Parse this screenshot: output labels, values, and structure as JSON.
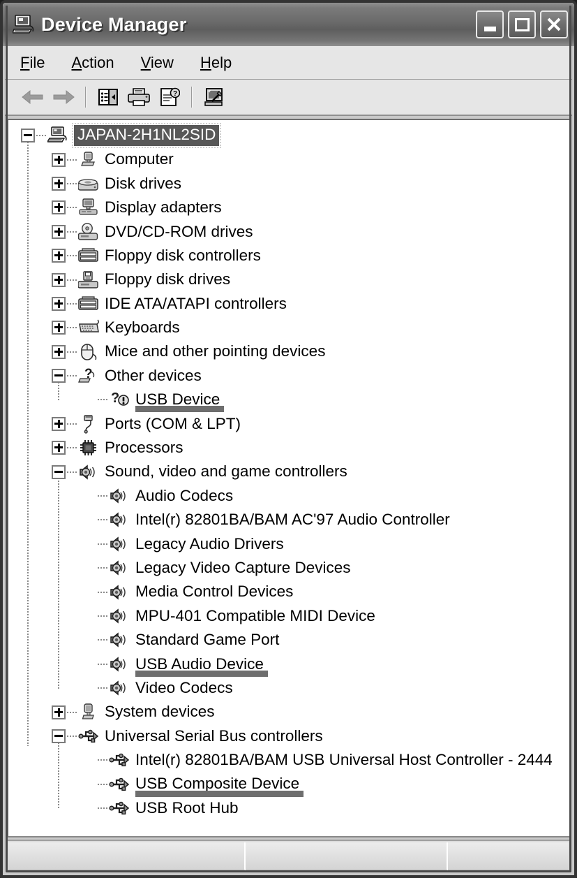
{
  "window": {
    "title": "Device Manager",
    "title_icon": "computer-icon",
    "caption_buttons": [
      {
        "name": "minimize",
        "label": "_"
      },
      {
        "name": "maximize",
        "label": "□"
      },
      {
        "name": "close",
        "label": "X"
      }
    ]
  },
  "menu": {
    "items": [
      {
        "label": "File",
        "accel": "F"
      },
      {
        "label": "Action",
        "accel": "A"
      },
      {
        "label": "View",
        "accel": "V"
      },
      {
        "label": "Help",
        "accel": "H"
      }
    ]
  },
  "toolbar": {
    "buttons": [
      {
        "name": "back-arrow-icon",
        "tip": "Back"
      },
      {
        "name": "forward-arrow-icon",
        "tip": "Forward"
      },
      {
        "name": "separator",
        "tip": ""
      },
      {
        "name": "show-console-tree-icon",
        "tip": "Show/Hide Console Tree"
      },
      {
        "name": "print-icon",
        "tip": "Print"
      },
      {
        "name": "properties-icon",
        "tip": "Properties"
      },
      {
        "name": "separator",
        "tip": ""
      },
      {
        "name": "scan-hardware-changes-icon",
        "tip": "Scan for hardware changes"
      }
    ]
  },
  "tree": {
    "rows": [
      {
        "id": "root",
        "depth": 0,
        "state": "expanded",
        "icon": "computer-icon",
        "label": "JAPAN-2H1NL2SID",
        "selected": true,
        "annotated": false
      },
      {
        "id": "computer",
        "depth": 1,
        "state": "collapsed",
        "icon": "computer-node-icon",
        "label": "Computer",
        "selected": false,
        "annotated": false
      },
      {
        "id": "disk",
        "depth": 1,
        "state": "collapsed",
        "icon": "disk-drive-icon",
        "label": "Disk drives",
        "selected": false,
        "annotated": false
      },
      {
        "id": "display",
        "depth": 1,
        "state": "collapsed",
        "icon": "display-adapter-icon",
        "label": "Display adapters",
        "selected": false,
        "annotated": false
      },
      {
        "id": "dvd",
        "depth": 1,
        "state": "collapsed",
        "icon": "dvd-drive-icon",
        "label": "DVD/CD-ROM drives",
        "selected": false,
        "annotated": false
      },
      {
        "id": "fdc",
        "depth": 1,
        "state": "collapsed",
        "icon": "controller-icon",
        "label": "Floppy disk controllers",
        "selected": false,
        "annotated": false
      },
      {
        "id": "fdd",
        "depth": 1,
        "state": "collapsed",
        "icon": "floppy-drive-icon",
        "label": "Floppy disk drives",
        "selected": false,
        "annotated": false
      },
      {
        "id": "ide",
        "depth": 1,
        "state": "collapsed",
        "icon": "controller-icon",
        "label": "IDE ATA/ATAPI controllers",
        "selected": false,
        "annotated": false
      },
      {
        "id": "keyboards",
        "depth": 1,
        "state": "collapsed",
        "icon": "keyboard-icon",
        "label": "Keyboards",
        "selected": false,
        "annotated": false
      },
      {
        "id": "mice",
        "depth": 1,
        "state": "collapsed",
        "icon": "mouse-icon",
        "label": "Mice and other pointing devices",
        "selected": false,
        "annotated": false
      },
      {
        "id": "other",
        "depth": 1,
        "state": "expanded",
        "icon": "unknown-device-icon",
        "label": "Other devices",
        "selected": false,
        "annotated": false
      },
      {
        "id": "usbdev",
        "depth": 2,
        "state": "leaf",
        "icon": "unknown-warning-icon",
        "label": "USB Device",
        "selected": false,
        "annotated": true
      },
      {
        "id": "ports",
        "depth": 1,
        "state": "collapsed",
        "icon": "port-icon",
        "label": "Ports (COM & LPT)",
        "selected": false,
        "annotated": false
      },
      {
        "id": "cpu",
        "depth": 1,
        "state": "collapsed",
        "icon": "processor-icon",
        "label": "Processors",
        "selected": false,
        "annotated": false
      },
      {
        "id": "sound",
        "depth": 1,
        "state": "expanded",
        "icon": "speaker-icon",
        "label": "Sound, video and game controllers",
        "selected": false,
        "annotated": false
      },
      {
        "id": "audcodec",
        "depth": 2,
        "state": "leaf",
        "icon": "speaker-icon",
        "label": "Audio Codecs",
        "selected": false,
        "annotated": false
      },
      {
        "id": "intelac97",
        "depth": 2,
        "state": "leaf",
        "icon": "speaker-icon",
        "label": "Intel(r) 82801BA/BAM AC'97 Audio Controller",
        "selected": false,
        "annotated": false
      },
      {
        "id": "legaudio",
        "depth": 2,
        "state": "leaf",
        "icon": "speaker-icon",
        "label": "Legacy Audio Drivers",
        "selected": false,
        "annotated": false
      },
      {
        "id": "legvideo",
        "depth": 2,
        "state": "leaf",
        "icon": "speaker-icon",
        "label": "Legacy Video Capture Devices",
        "selected": false,
        "annotated": false
      },
      {
        "id": "mediactl",
        "depth": 2,
        "state": "leaf",
        "icon": "speaker-icon",
        "label": "Media Control Devices",
        "selected": false,
        "annotated": false
      },
      {
        "id": "mpu401",
        "depth": 2,
        "state": "leaf",
        "icon": "speaker-icon",
        "label": "MPU-401 Compatible MIDI Device",
        "selected": false,
        "annotated": false
      },
      {
        "id": "gameport",
        "depth": 2,
        "state": "leaf",
        "icon": "speaker-icon",
        "label": "Standard Game Port",
        "selected": false,
        "annotated": false
      },
      {
        "id": "usbaudio",
        "depth": 2,
        "state": "leaf",
        "icon": "speaker-icon",
        "label": "USB Audio Device",
        "selected": false,
        "annotated": true
      },
      {
        "id": "vidcodec",
        "depth": 2,
        "state": "leaf",
        "icon": "speaker-icon",
        "label": "Video Codecs",
        "selected": false,
        "annotated": false
      },
      {
        "id": "sysdev",
        "depth": 1,
        "state": "collapsed",
        "icon": "system-device-icon",
        "label": "System devices",
        "selected": false,
        "annotated": false
      },
      {
        "id": "usbctrl",
        "depth": 1,
        "state": "expanded",
        "icon": "usb-icon",
        "label": "Universal Serial Bus controllers",
        "selected": false,
        "annotated": false
      },
      {
        "id": "usbhost",
        "depth": 2,
        "state": "leaf",
        "icon": "usb-icon",
        "label": "Intel(r) 82801BA/BAM USB Universal Host Controller - 2444",
        "selected": false,
        "annotated": false
      },
      {
        "id": "usbcomp",
        "depth": 2,
        "state": "leaf",
        "icon": "usb-icon",
        "label": "USB Composite Device",
        "selected": false,
        "annotated": true
      },
      {
        "id": "usbroot",
        "depth": 2,
        "state": "leaf",
        "icon": "usb-icon",
        "label": "USB Root Hub",
        "selected": false,
        "annotated": false
      }
    ]
  },
  "statusbar": {
    "panes": [
      "",
      "",
      ""
    ]
  },
  "colors": {
    "titlebar": "#6a6a6a",
    "selection_bg": "#585858",
    "selection_fg": "#ffffff",
    "annotation_bar": "#6e6e6e",
    "panel_bg": "#e6e6e6",
    "tree_bg": "#ffffff",
    "frame": "#333333"
  }
}
